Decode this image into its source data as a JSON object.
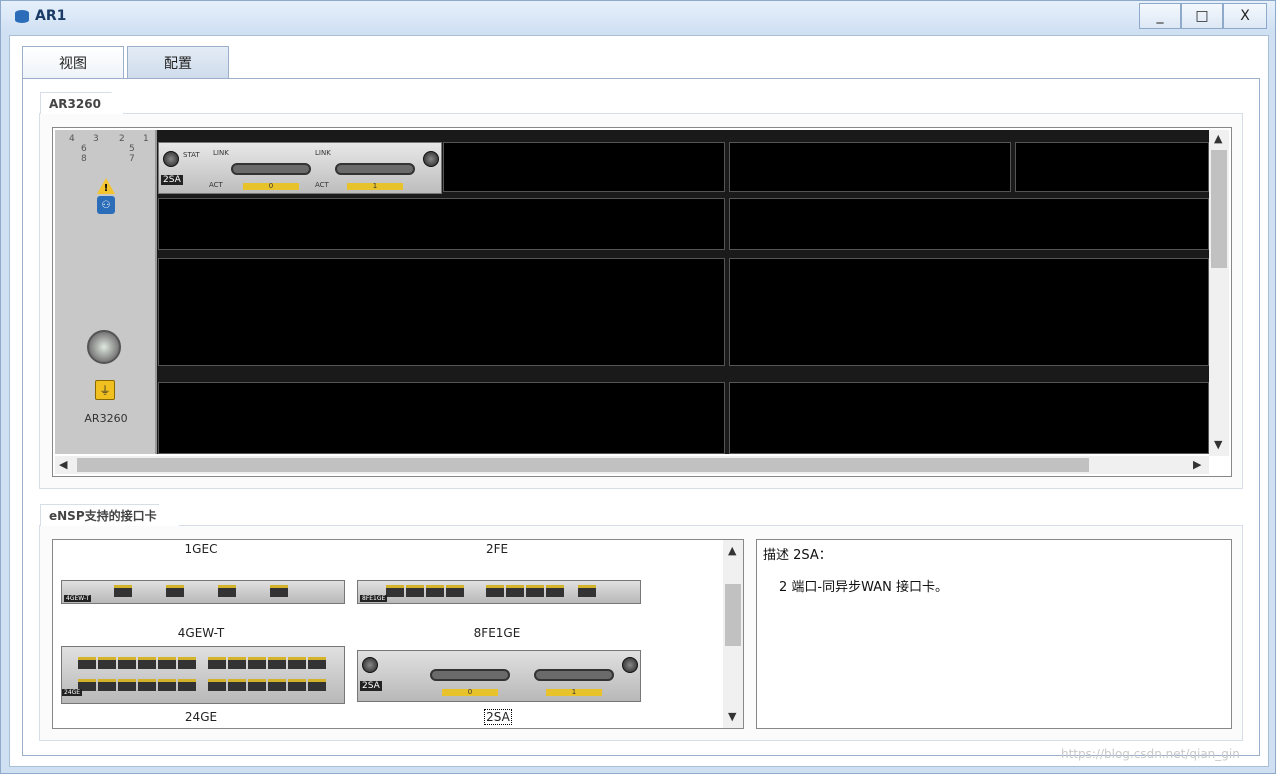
{
  "window": {
    "title": "AR1",
    "min_label": "_",
    "max_label": "□",
    "close_label": "X"
  },
  "tabs": [
    {
      "label": "视图"
    },
    {
      "label": "配置"
    }
  ],
  "chassis_group": {
    "title": "AR3260",
    "slot_map": [
      "4",
      "3",
      "2",
      "1",
      "6",
      "5",
      "8",
      "7"
    ],
    "chassis_label": "AR3260",
    "installed_card": {
      "badge": "2SA",
      "stat": "STAT",
      "link": "LINK",
      "act": "ACT",
      "port0": "0",
      "port1": "1"
    }
  },
  "cards_group": {
    "title": "eNSP支持的接口卡",
    "cards": [
      {
        "name": "1GEC",
        "badge": "4GEW-T"
      },
      {
        "name": "2FE",
        "badge": "8FE1GE"
      },
      {
        "name": "4GEW-T",
        "badge": "24GE"
      },
      {
        "name": "8FE1GE",
        "badge": "2SA"
      },
      {
        "name": "24GE"
      },
      {
        "name": "2SA"
      }
    ],
    "description_title": "描述 2SA：",
    "description_text": "2 端口-同异步WAN 接口卡。"
  },
  "watermark": "https://blog.csdn.net/qian_gin",
  "colors": {
    "titlebar": "#cfe0f3",
    "port_yellow": "#e8c22a",
    "slot_black": "#000000"
  }
}
